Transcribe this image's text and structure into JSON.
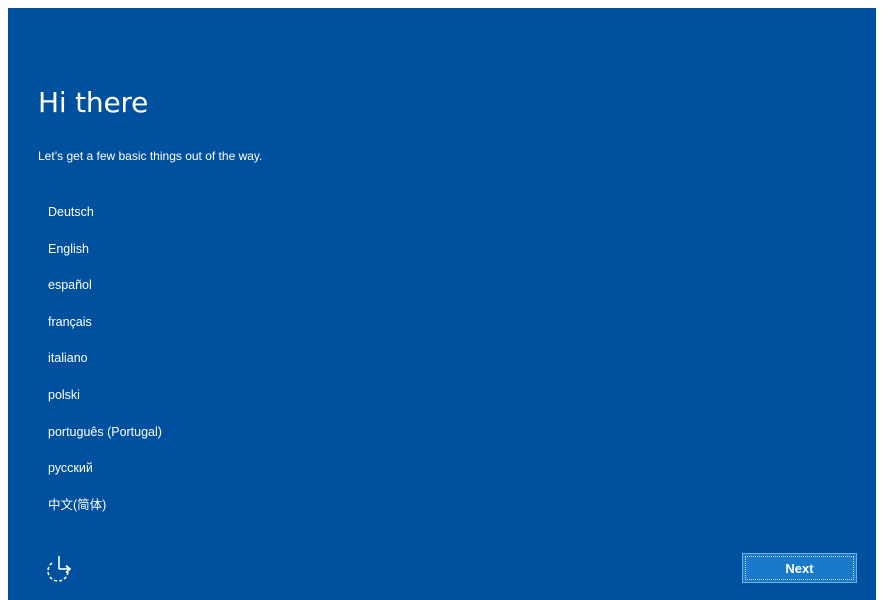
{
  "header": {
    "title": "Hi there",
    "subtitle": "Let’s get a few basic things out of the way."
  },
  "languages": [
    "Deutsch",
    "English",
    "español",
    "français",
    "italiano",
    "polski",
    "português (Portugal)",
    "русский",
    "中文(简体)"
  ],
  "footer": {
    "ease_of_access_icon": "ease-of-access-icon",
    "next_label": "Next"
  },
  "colors": {
    "background": "#0050a0",
    "button": "#1979ca",
    "text": "#ffffff"
  }
}
